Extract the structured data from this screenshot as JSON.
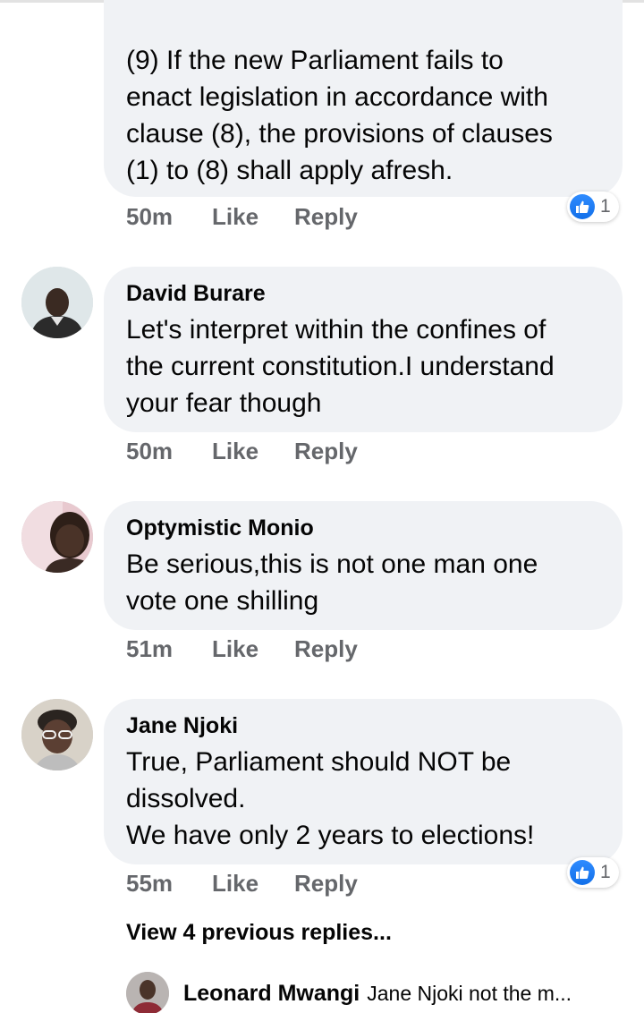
{
  "comments": [
    {
      "author": "",
      "text": "(9) If the new Parliament fails to\nenact legislation in accordance with\nclause (8), the provisions of clauses\n(1) to (8) shall apply afresh.",
      "time": "50m",
      "like_label": "Like",
      "reply_label": "Reply",
      "reaction_count": "1"
    },
    {
      "author": "David Burare",
      "text": "Let's interpret within the confines of\nthe current constitution.I understand\nyour fear though",
      "time": "50m",
      "like_label": "Like",
      "reply_label": "Reply"
    },
    {
      "author": "Optymistic Monio",
      "text": "Be serious,this is not one man one\nvote one shilling",
      "time": "51m",
      "like_label": "Like",
      "reply_label": "Reply"
    },
    {
      "author": "Jane Njoki",
      "text": "True, Parliament should NOT be\ndissolved.\nWe have only 2 years to elections!",
      "time": "55m",
      "like_label": "Like",
      "reply_label": "Reply",
      "reaction_count": "1"
    }
  ],
  "view_more_label": "View 4 previous replies...",
  "reply_preview": {
    "author": "Leonard Mwangi",
    "text": "Jane Njoki not the m..."
  },
  "icons": {
    "reaction": "like-thumb-icon",
    "avatars": "profile-photo"
  },
  "colors": {
    "bubble": "#f0f2f5",
    "meta_text": "#65676b",
    "like_blue": "#1877f2"
  }
}
